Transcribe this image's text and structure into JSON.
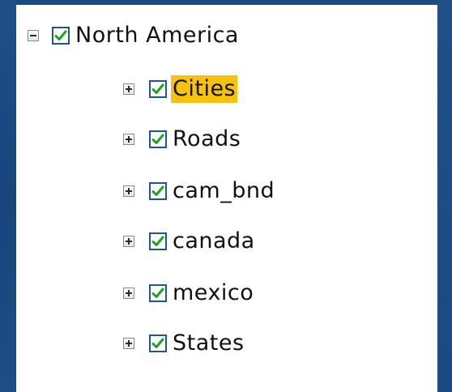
{
  "tree": {
    "root": {
      "label": "North America",
      "expanded": true,
      "checked": true
    },
    "children": [
      {
        "label": "Cities",
        "expanded": false,
        "checked": true,
        "selected": true
      },
      {
        "label": "Roads",
        "expanded": false,
        "checked": true,
        "selected": false
      },
      {
        "label": "cam_bnd",
        "expanded": false,
        "checked": true,
        "selected": false
      },
      {
        "label": "canada",
        "expanded": false,
        "checked": true,
        "selected": false
      },
      {
        "label": "mexico",
        "expanded": false,
        "checked": true,
        "selected": false
      },
      {
        "label": "States",
        "expanded": false,
        "checked": true,
        "selected": false
      }
    ]
  },
  "colors": {
    "background": "#1b4a82",
    "panel": "#ffffff",
    "selection": "#f6c20d",
    "checkmark": "#1aa321",
    "checkbox_border": "#21558f"
  },
  "icons": {
    "collapse": "minus-box-icon",
    "expand": "plus-box-icon",
    "checked": "checkmark-icon"
  }
}
